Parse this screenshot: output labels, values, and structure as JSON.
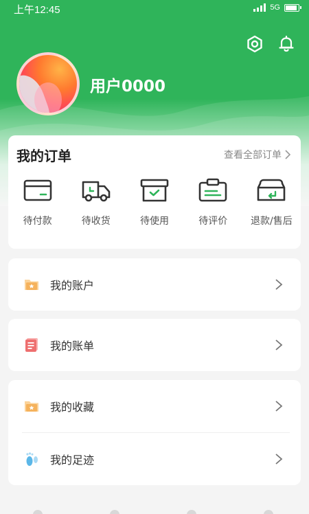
{
  "status_bar": {
    "time": "上午12:45",
    "network": "5G"
  },
  "header": {
    "username": "用户0000",
    "icons": [
      "settings-icon",
      "bell-icon"
    ]
  },
  "orders": {
    "title": "我的订单",
    "view_all": "查看全部订单",
    "items": [
      {
        "label": "待付款",
        "icon": "card-icon"
      },
      {
        "label": "待收货",
        "icon": "truck-icon"
      },
      {
        "label": "待使用",
        "icon": "box-check-icon"
      },
      {
        "label": "待评价",
        "icon": "clipboard-icon"
      },
      {
        "label": "退款/售后",
        "icon": "refund-box-icon"
      }
    ]
  },
  "menu": {
    "account": {
      "label": "我的账户",
      "icon": "folder-star-icon"
    },
    "bill": {
      "label": "我的账单",
      "icon": "bill-icon"
    },
    "favorites": {
      "label": "我的收藏",
      "icon": "folder-star-icon"
    },
    "footprint": {
      "label": "我的足迹",
      "icon": "footprint-icon"
    }
  },
  "colors": {
    "brand_green": "#2fb45a",
    "icon_orange": "#f5b25c",
    "icon_red": "#ee6f6f",
    "icon_blue": "#5bb7e8"
  }
}
